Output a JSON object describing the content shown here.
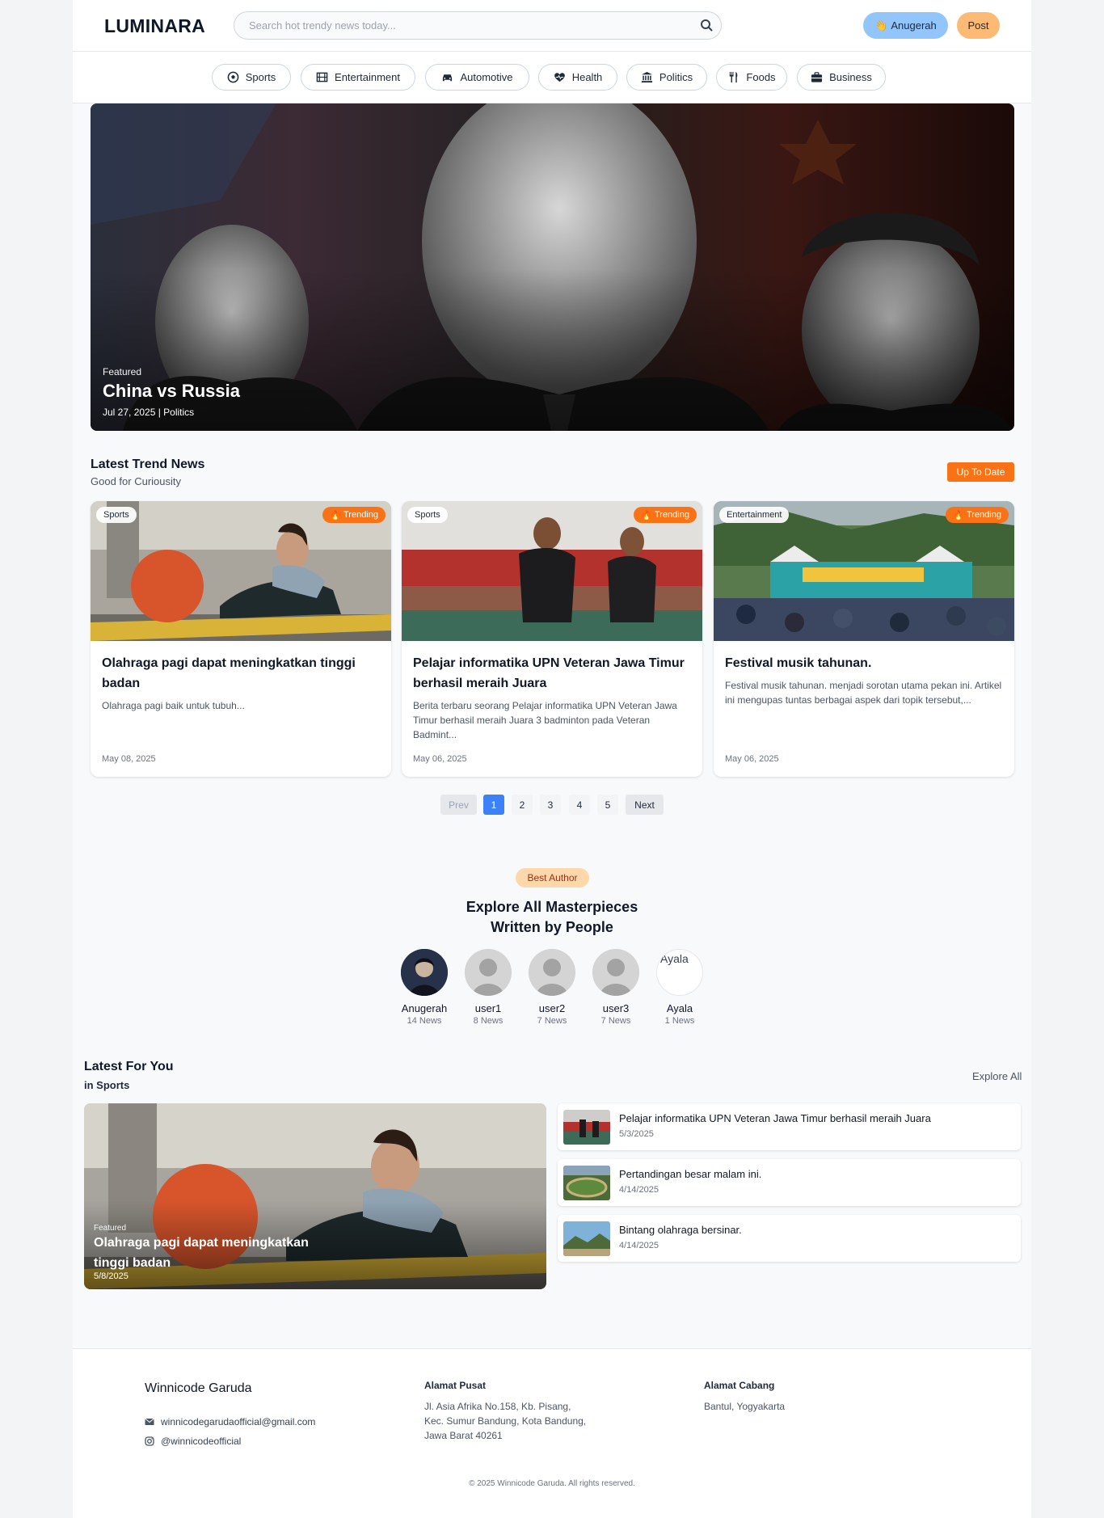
{
  "header": {
    "logo": "LUMINARA",
    "search_placeholder": "Search hot trendy news today...",
    "user_label": "Anugerah",
    "post_label": "Post"
  },
  "categories": [
    {
      "label": "Sports",
      "icon": "soccer-ball-icon"
    },
    {
      "label": "Entertainment",
      "icon": "film-icon"
    },
    {
      "label": "Automotive",
      "icon": "car-icon"
    },
    {
      "label": "Health",
      "icon": "heart-pulse-icon"
    },
    {
      "label": "Politics",
      "icon": "landmark-icon"
    },
    {
      "label": "Foods",
      "icon": "utensils-icon"
    },
    {
      "label": "Business",
      "icon": "briefcase-icon"
    }
  ],
  "hero": {
    "tag": "Featured",
    "title": "China vs Russia",
    "meta": "Jul 27, 2025 | Politics"
  },
  "trend": {
    "title": "Latest Trend News",
    "subtitle": "Good for Curiousity",
    "button": "Up To Date",
    "trending_label": "Trending",
    "cards": [
      {
        "category": "Sports",
        "title": "Olahraga pagi dapat meningkatkan tinggi badan",
        "excerpt": "Olahraga pagi baik untuk tubuh...",
        "date": "May 08, 2025"
      },
      {
        "category": "Sports",
        "title": "Pelajar informatika UPN Veteran Jawa Timur berhasil meraih Juara",
        "excerpt": "Berita terbaru seorang Pelajar informatika UPN Veteran Jawa Timur berhasil meraih Juara 3 badminton pada Veteran Badmint...",
        "date": "May 06, 2025"
      },
      {
        "category": "Entertainment",
        "title": "Festival musik tahunan.",
        "excerpt": "Festival musik tahunan. menjadi sorotan utama pekan ini. Artikel ini mengupas tuntas berbagai aspek dari topik tersebut,...",
        "date": "May 06, 2025"
      }
    ]
  },
  "pagination": {
    "prev": "Prev",
    "pages": [
      "1",
      "2",
      "3",
      "4",
      "5"
    ],
    "next": "Next",
    "active": "1"
  },
  "authors": {
    "badge": "Best Author",
    "title_line1": "Explore All Masterpieces",
    "title_line2": "Written by People",
    "list": [
      {
        "name": "Anugerah",
        "count": "14 News"
      },
      {
        "name": "user1",
        "count": "8 News"
      },
      {
        "name": "user2",
        "count": "7 News"
      },
      {
        "name": "user3",
        "count": "7 News"
      },
      {
        "name": "Ayala",
        "count": "1 News",
        "alt": "Ayala"
      }
    ]
  },
  "latest_for_you": {
    "title": "Latest For You",
    "subtitle": "in Sports",
    "explore_all": "Explore All",
    "featured": {
      "tag": "Featured",
      "title": "Olahraga pagi dapat meningkatkan tinggi badan",
      "date": "5/8/2025"
    },
    "items": [
      {
        "title": "Pelajar informatika UPN Veteran Jawa Timur berhasil meraih Juara",
        "date": "5/3/2025"
      },
      {
        "title": "Pertandingan besar malam ini.",
        "date": "4/14/2025"
      },
      {
        "title": "Bintang olahraga bersinar.",
        "date": "4/14/2025"
      }
    ]
  },
  "footer": {
    "brand": "Winnicode Garuda",
    "email": "winnicodegarudaofficial@gmail.com",
    "instagram": "@winnicodeofficial",
    "hq_title": "Alamat Pusat",
    "hq_line1": "Jl. Asia Afrika No.158, Kb. Pisang,",
    "hq_line2": "Kec. Sumur Bandung, Kota Bandung,",
    "hq_line3": "Jawa Barat 40261",
    "branch_title": "Alamat Cabang",
    "branch_line1": "Bantul, Yogyakarta",
    "copyright": "© 2025 Winnicode Garuda. All rights reserved."
  },
  "colors": {
    "accent_orange": "#f97316",
    "user_pill": "#93c5fd",
    "post_button": "#fdba74",
    "active_page": "#3b82f6"
  }
}
